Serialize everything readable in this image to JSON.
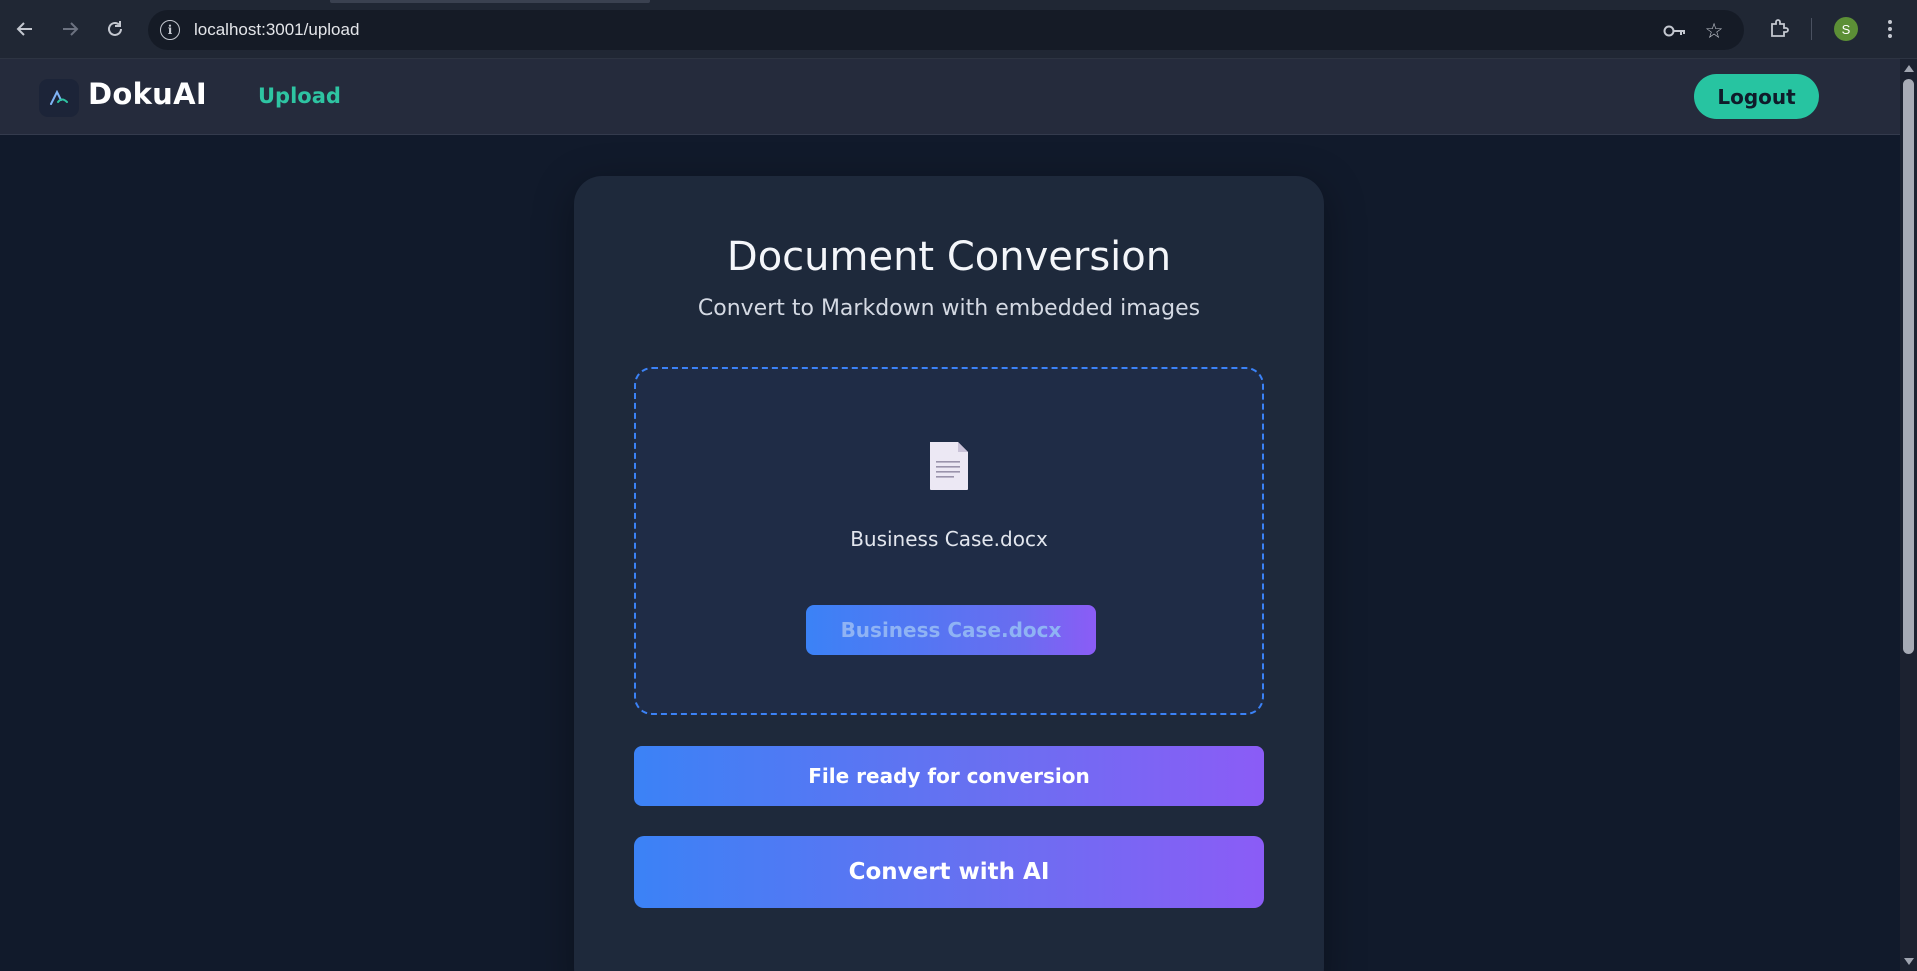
{
  "browser": {
    "url": "localhost:3001/upload",
    "profile_initial": "S"
  },
  "header": {
    "brand": "DokuAI",
    "nav_upload": "Upload",
    "logout": "Logout"
  },
  "card": {
    "title": "Document Conversion",
    "subtitle": "Convert to Markdown with embedded images",
    "dropzone": {
      "file_name": "Business Case.docx",
      "file_button_label": "Business Case.docx"
    },
    "status": "File ready for conversion",
    "convert_button": "Convert with AI"
  },
  "colors": {
    "background": "#111a2b",
    "card": "#1e293b",
    "accent_teal": "#27c4a1",
    "gradient_start": "#3b82f6",
    "gradient_end": "#8b5cf6"
  }
}
